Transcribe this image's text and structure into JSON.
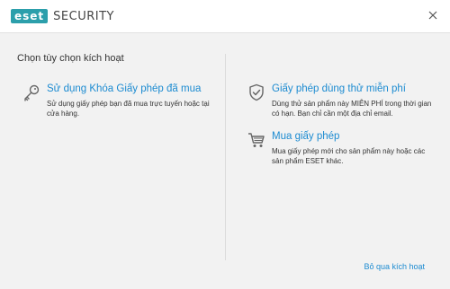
{
  "titlebar": {
    "logo_mark": "eset",
    "product_name": "SECURITY",
    "brand_color": "#2c9fab",
    "close_icon": "close-icon"
  },
  "page": {
    "heading": "Chọn tùy chọn kích hoạt"
  },
  "options": [
    {
      "title": "Sử dụng Khóa Giấy phép đã mua",
      "description": "Sử dụng giấy phép bạn đã mua trực tuyến hoặc tại cửa hàng.",
      "icon": "key-icon"
    },
    {
      "title": "Giấy phép dùng thử miễn phí",
      "description": "Dùng thử sản phẩm này MIỄN PHÍ trong thời gian có hạn. Bạn chỉ cần một địa chỉ email.",
      "icon": "shield-check-icon"
    },
    {
      "title": "Mua giấy phép",
      "description": "Mua giấy phép mới cho sản phẩm này hoặc các sản phẩm ESET khác.",
      "icon": "shopping-cart-icon"
    }
  ],
  "footer": {
    "skip_label": "Bỏ qua kích hoạt"
  },
  "colors": {
    "link": "#1c8bd1",
    "background": "#f2f2f2",
    "icon": "#666666"
  }
}
